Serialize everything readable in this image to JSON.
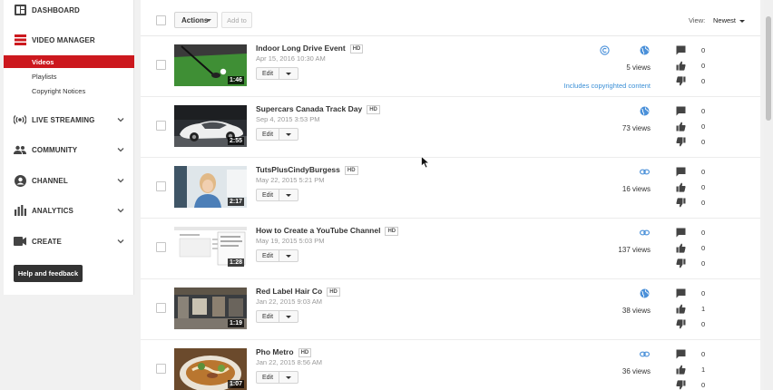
{
  "sidebar": {
    "dashboard": "DASHBOARD",
    "video_manager": "VIDEO MANAGER",
    "sub_items": [
      "Videos",
      "Playlists",
      "Copyright Notices"
    ],
    "sections": [
      "LIVE STREAMING",
      "COMMUNITY",
      "CHANNEL",
      "ANALYTICS",
      "CREATE"
    ],
    "help": "Help and feedback"
  },
  "toolbar": {
    "actions": "Actions",
    "add_to": "Add to",
    "view_label": "View:",
    "sort": "Newest"
  },
  "colors": {
    "accent_red": "#cc181e",
    "link_blue": "#3a8fd6"
  },
  "videos": [
    {
      "title": "Indoor Long Drive Event",
      "hd": "HD",
      "date": "Apr 15, 2016 10:30 AM",
      "duration": "1:46",
      "edit": "Edit",
      "views": "5 views",
      "visibility": "globe-icon",
      "copyright_icon": "copyright-icon",
      "copyright_note": "Includes copyrighted content",
      "comments": "0",
      "likes": "0",
      "dislikes": "0"
    },
    {
      "title": "Supercars Canada Track Day",
      "hd": "HD",
      "date": "Sep 4, 2015 3:53 PM",
      "duration": "2:55",
      "edit": "Edit",
      "views": "73 views",
      "visibility": "globe-icon",
      "comments": "0",
      "likes": "0",
      "dislikes": "0"
    },
    {
      "title": "TutsPlusCindyBurgess",
      "hd": "HD",
      "date": "May 22, 2015 5:21 PM",
      "duration": "2:17",
      "edit": "Edit",
      "views": "16 views",
      "visibility": "link-icon",
      "comments": "0",
      "likes": "0",
      "dislikes": "0"
    },
    {
      "title": "How to Create a YouTube Channel",
      "hd": "HD",
      "date": "May 19, 2015 5:03 PM",
      "duration": "1:28",
      "edit": "Edit",
      "views": "137 views",
      "visibility": "link-icon",
      "comments": "0",
      "likes": "0",
      "dislikes": "0"
    },
    {
      "title": "Red Label Hair Co",
      "hd": "HD",
      "date": "Jan 22, 2015 9:03 AM",
      "duration": "1:19",
      "edit": "Edit",
      "views": "38 views",
      "visibility": "globe-icon",
      "comments": "0",
      "likes": "1",
      "dislikes": "0"
    },
    {
      "title": "Pho Metro",
      "hd": "HD",
      "date": "Jan 22, 2015 8:56 AM",
      "duration": "1:07",
      "edit": "Edit",
      "views": "36 views",
      "visibility": "link-icon",
      "comments": "0",
      "likes": "1",
      "dislikes": "0"
    }
  ]
}
